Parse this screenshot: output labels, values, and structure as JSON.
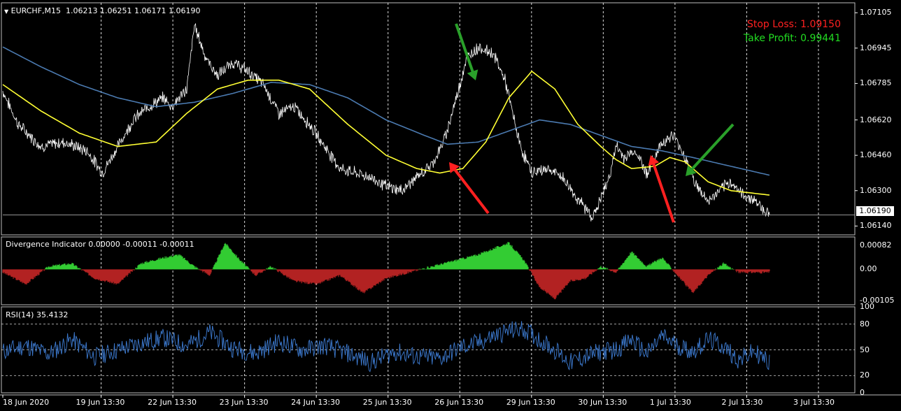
{
  "header": {
    "symbol": "EURCHF,M15",
    "ohlc": "1.06213 1.06251 1.06171 1.06190"
  },
  "stop_loss_text": "Stop Loss: 1.09150",
  "take_profit_text": "Take Profit: 0.99441",
  "current_price": "1.06190",
  "colors": {
    "background": "#000000",
    "price_line": "#ffffff",
    "fast_ma": "#ffff33",
    "slow_ma": "#4b7ab0",
    "div_positive": "#33cc33",
    "div_negative": "#b22222",
    "rsi_line": "#3d7bd1",
    "stop_loss": "#ff2020",
    "take_profit": "#22dd22",
    "grid": "#ffffff"
  },
  "chart_data": [
    {
      "type": "line",
      "panel": "main",
      "title": "EURCHF,M15",
      "price_axis_labels": [
        "1.07105",
        "1.06945",
        "1.06785",
        "1.06620",
        "1.06460",
        "1.06300",
        "1.06140"
      ],
      "price_axis_values": [
        1.07105,
        1.06945,
        1.06785,
        1.0662,
        1.0646,
        1.063,
        1.0614
      ],
      "ylim": [
        1.061,
        1.0715
      ],
      "x_labels": [
        "18 Jun 2020",
        "19 Jun 13:30",
        "22 Jun 13:30",
        "23 Jun 13:30",
        "24 Jun 13:30",
        "25 Jun 13:30",
        "26 Jun 13:30",
        "29 Jun 13:30",
        "30 Jun 13:30",
        "1 Jul 13:30",
        "2 Jul 13:30",
        "3 Jul 13:30"
      ],
      "series": [
        {
          "name": "price",
          "color": "#ffffff",
          "t": [
            0,
            0.02,
            0.05,
            0.08,
            0.11,
            0.13,
            0.15,
            0.17,
            0.19,
            0.21,
            0.22,
            0.24,
            0.25,
            0.265,
            0.28,
            0.3,
            0.32,
            0.34,
            0.36,
            0.38,
            0.4,
            0.42,
            0.44,
            0.46,
            0.48,
            0.5,
            0.52,
            0.54,
            0.56,
            0.575,
            0.59,
            0.605,
            0.62,
            0.64,
            0.655,
            0.675,
            0.69,
            0.71,
            0.73,
            0.75,
            0.77,
            0.79,
            0.8,
            0.81,
            0.825,
            0.84,
            0.86,
            0.875,
            0.89,
            0.905,
            0.92,
            0.935,
            0.95,
            0.965,
            0.98,
            1.0
          ],
          "v": [
            1.0675,
            1.066,
            1.065,
            1.0652,
            1.0648,
            1.0638,
            1.065,
            1.0662,
            1.0668,
            1.0672,
            1.0668,
            1.0676,
            1.0705,
            1.069,
            1.0682,
            1.0688,
            1.0684,
            1.0678,
            1.0665,
            1.0668,
            1.066,
            1.065,
            1.064,
            1.0638,
            1.0636,
            1.0632,
            1.063,
            1.0636,
            1.0642,
            1.0652,
            1.067,
            1.069,
            1.0695,
            1.0692,
            1.068,
            1.065,
            1.0638,
            1.064,
            1.0636,
            1.0626,
            1.0618,
            1.0635,
            1.065,
            1.0645,
            1.0648,
            1.0638,
            1.0652,
            1.0655,
            1.0645,
            1.0632,
            1.0625,
            1.063,
            1.0634,
            1.0628,
            1.0626,
            1.0619
          ]
        },
        {
          "name": "fast_ma",
          "color": "#ffff33",
          "t": [
            0,
            0.05,
            0.1,
            0.15,
            0.2,
            0.24,
            0.28,
            0.32,
            0.36,
            0.4,
            0.45,
            0.5,
            0.54,
            0.57,
            0.6,
            0.63,
            0.66,
            0.69,
            0.72,
            0.75,
            0.78,
            0.8,
            0.82,
            0.85,
            0.87,
            0.89,
            0.92,
            0.95,
            1.0
          ],
          "v": [
            1.0678,
            1.0666,
            1.0656,
            1.065,
            1.0652,
            1.0665,
            1.0676,
            1.068,
            1.068,
            1.0676,
            1.066,
            1.0646,
            1.064,
            1.0638,
            1.064,
            1.0652,
            1.0672,
            1.0684,
            1.0676,
            1.066,
            1.065,
            1.0644,
            1.064,
            1.0641,
            1.0645,
            1.0643,
            1.0634,
            1.063,
            1.0628
          ]
        },
        {
          "name": "slow_ma",
          "color": "#4b7ab0",
          "t": [
            0,
            0.05,
            0.1,
            0.15,
            0.2,
            0.25,
            0.3,
            0.35,
            0.4,
            0.45,
            0.5,
            0.55,
            0.58,
            0.62,
            0.66,
            0.7,
            0.74,
            0.78,
            0.82,
            0.86,
            0.9,
            0.95,
            1.0
          ],
          "v": [
            1.0695,
            1.0686,
            1.0678,
            1.0672,
            1.0668,
            1.067,
            1.0674,
            1.0679,
            1.0678,
            1.0672,
            1.0662,
            1.0655,
            1.0651,
            1.0652,
            1.0657,
            1.0662,
            1.066,
            1.0655,
            1.065,
            1.0648,
            1.0645,
            1.0641,
            1.0637
          ]
        }
      ],
      "arrows": [
        {
          "color": "green",
          "direction": "down",
          "at_t": 0.61
        },
        {
          "color": "red",
          "direction": "up",
          "at_t": 0.58
        },
        {
          "color": "red",
          "direction": "up",
          "at_t": 0.85
        },
        {
          "color": "green",
          "direction": "down",
          "at_t": 0.89
        }
      ]
    },
    {
      "type": "area",
      "panel": "divergence",
      "title": "Divergence Indicator 0.00000 -0.00011 -0.00011",
      "axis_labels": [
        "0.00082",
        "0.00",
        "-0.00105"
      ],
      "axis_values": [
        0.00082,
        0.0,
        -0.00105
      ],
      "ylim": [
        -0.0012,
        0.0011
      ],
      "t": [
        0,
        0.03,
        0.06,
        0.09,
        0.12,
        0.15,
        0.18,
        0.21,
        0.23,
        0.25,
        0.27,
        0.29,
        0.31,
        0.33,
        0.35,
        0.38,
        0.41,
        0.44,
        0.47,
        0.5,
        0.53,
        0.56,
        0.59,
        0.62,
        0.64,
        0.66,
        0.68,
        0.7,
        0.72,
        0.74,
        0.76,
        0.78,
        0.8,
        0.82,
        0.84,
        0.86,
        0.88,
        0.9,
        0.92,
        0.94,
        0.96,
        0.98,
        1.0
      ],
      "values": [
        -0.0001,
        -0.0005,
        0.0001,
        0.0002,
        -0.0003,
        -0.0005,
        0.0002,
        0.0004,
        0.0005,
        0.0001,
        -0.0002,
        0.0009,
        0.0003,
        -0.0002,
        0.0001,
        -0.0004,
        -0.0005,
        -0.0002,
        -0.0008,
        -0.0003,
        -0.0001,
        0.0001,
        0.0003,
        0.0005,
        0.0007,
        0.0009,
        0.0003,
        -0.0006,
        -0.001,
        -0.0004,
        -0.0003,
        0.0001,
        -0.0001,
        0.0006,
        0.0001,
        0.0004,
        -0.0002,
        -0.0008,
        -0.0002,
        0.0002,
        -0.0001,
        -0.0001,
        -0.0001
      ]
    },
    {
      "type": "line",
      "panel": "rsi",
      "title": "RSI(14) 35.4132",
      "axis_labels": [
        "100",
        "80",
        "50",
        "20",
        "0"
      ],
      "axis_values": [
        100,
        80,
        50,
        20,
        0
      ],
      "levels": [
        80,
        50,
        20
      ],
      "ylim": [
        0,
        100
      ],
      "t": [
        0,
        0.03,
        0.06,
        0.09,
        0.12,
        0.15,
        0.18,
        0.21,
        0.24,
        0.27,
        0.3,
        0.33,
        0.36,
        0.39,
        0.42,
        0.45,
        0.48,
        0.51,
        0.54,
        0.57,
        0.6,
        0.62,
        0.64,
        0.66,
        0.68,
        0.7,
        0.72,
        0.74,
        0.76,
        0.78,
        0.8,
        0.82,
        0.84,
        0.86,
        0.88,
        0.9,
        0.92,
        0.94,
        0.96,
        0.98,
        1.0
      ],
      "values": [
        48,
        55,
        45,
        62,
        42,
        50,
        58,
        64,
        55,
        70,
        52,
        46,
        60,
        50,
        55,
        46,
        35,
        48,
        42,
        40,
        54,
        58,
        66,
        72,
        74,
        62,
        50,
        35,
        42,
        48,
        50,
        62,
        45,
        66,
        55,
        48,
        62,
        54,
        38,
        48,
        35
      ]
    }
  ]
}
